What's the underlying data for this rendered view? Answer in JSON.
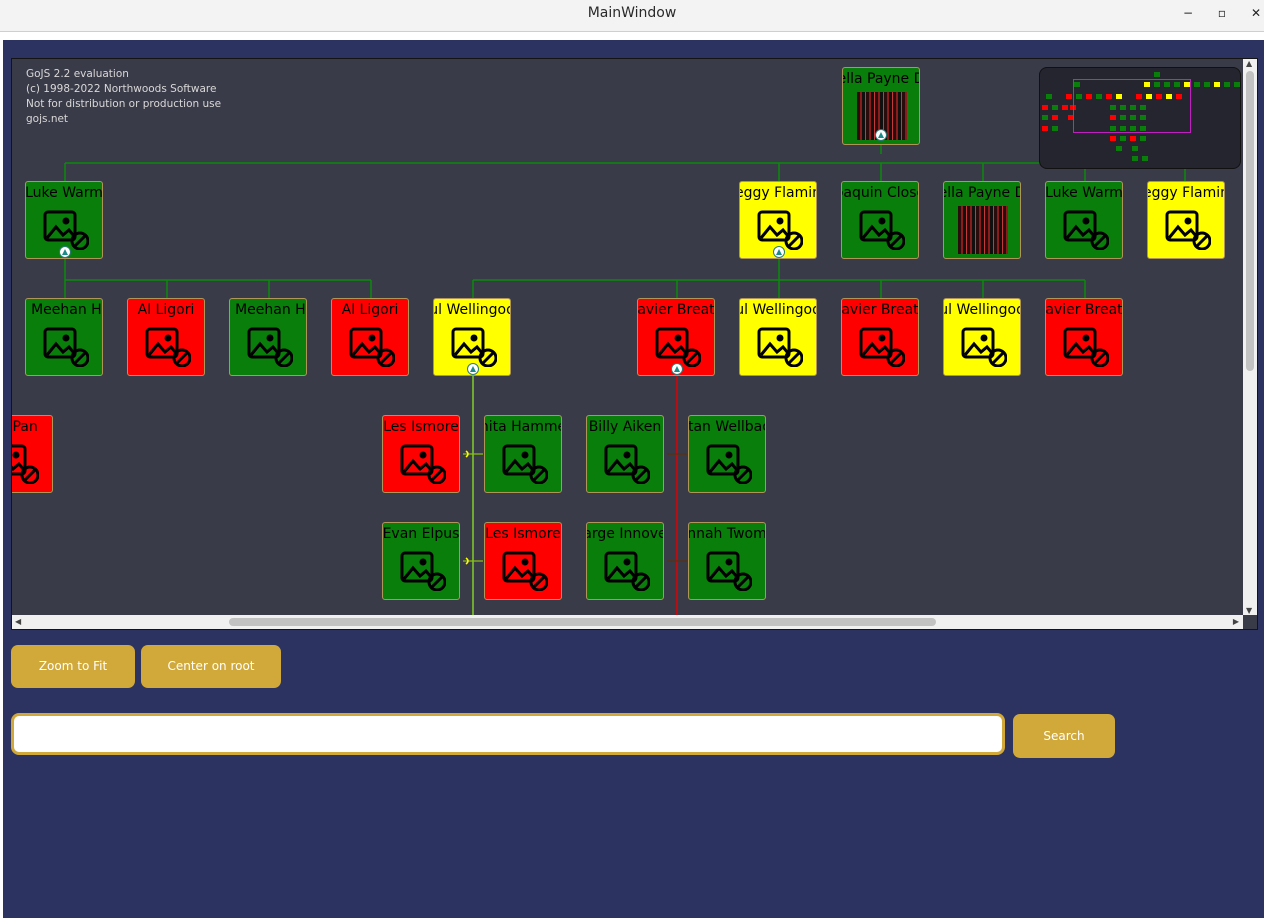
{
  "window": {
    "title": "MainWindow",
    "minimize": "−",
    "maximize": "▫",
    "close": "✕"
  },
  "watermark": [
    "GoJS 2.2 evaluation",
    "(c) 1998-2022 Northwoods Software",
    "Not for distribution or production use",
    "gojs.net"
  ],
  "nodes": {
    "root": "ella Payne D",
    "l1a": "Luke Warm",
    "l1b": "eggy Flamin",
    "l1c": "oaquin Close",
    "l1d": "ella Payne D",
    "l1e": "Luke Warm",
    "l1f": "eggy Flamin",
    "l2a": "g Meehan Ho",
    "l2b": "Al Ligori",
    "l2c": "g Meehan Ho",
    "l2d": "Al Ligori",
    "l2e": "ul Wellingoo",
    "l2f": "avier Breat",
    "l2g": "ul Wellingoo",
    "l2h": "avier Breat",
    "l2i": "ul Wellingoo",
    "l2j": "avier Breat",
    "l3a": "hn Pan",
    "l3b": "Les Ismore",
    "l3c": "nita Hamme",
    "l3d": "Billy Aiken",
    "l3e": "itan Wellbac",
    "l4a": "Evan Elpus",
    "l4b": "Les Ismore",
    "l4c": "arge Innove",
    "l4d": "nnah Twom"
  },
  "buttons": {
    "zoom_to_fit": "Zoom to Fit",
    "center_on_root": "Center on root",
    "search": "Search"
  },
  "search": {
    "value": "",
    "placeholder": ""
  },
  "colors": {
    "green": "#0a7e0a",
    "red": "#ff0000",
    "yellow": "#ffff00",
    "accent": "#d1a93a",
    "background": "#2d3360"
  }
}
